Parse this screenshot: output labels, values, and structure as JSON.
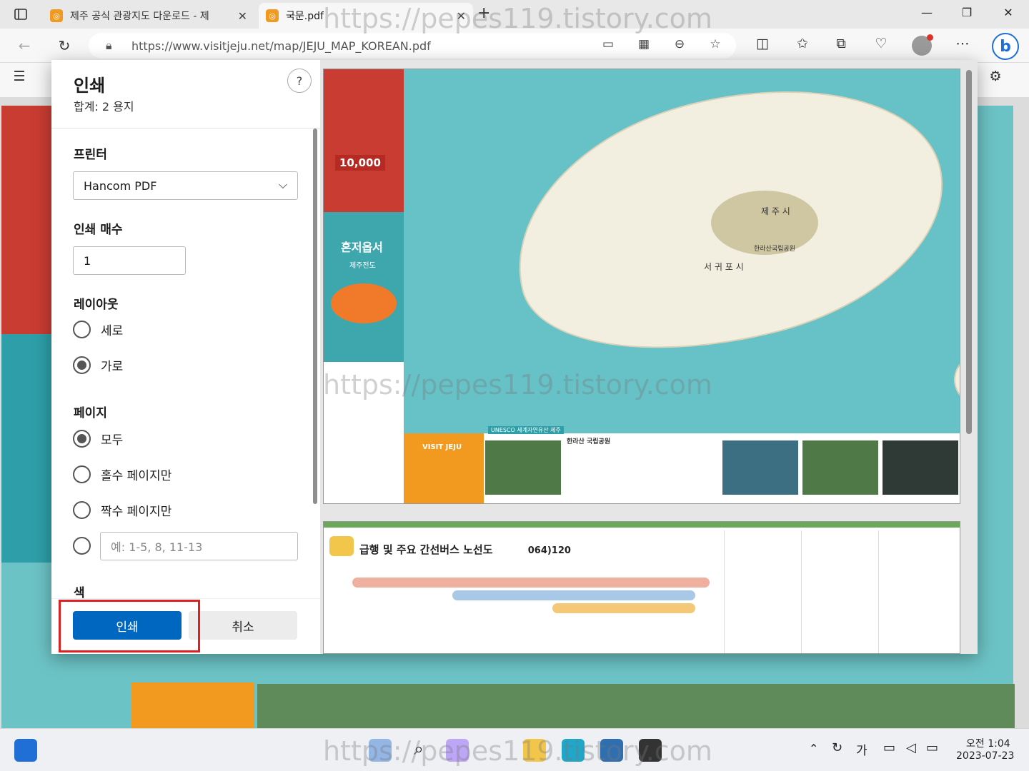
{
  "browser": {
    "tabs": [
      {
        "label": "제주 공식 관광지도 다운로드 - 제",
        "close": "✕"
      },
      {
        "label": "국문.pdf",
        "close": "✕"
      }
    ],
    "new_tab": "+",
    "address": "https://www.visitjeju.net/map/JEJU_MAP_KOREAN.pdf",
    "window_controls": {
      "minimize": "—",
      "restore": "❐",
      "close": "✕"
    }
  },
  "print_dialog": {
    "title": "인쇄",
    "total": "합계: 2 용지",
    "help": "?",
    "printer_label": "프린터",
    "printer_value": "Hancom PDF",
    "copies_label": "인쇄 매수",
    "copies_value": "1",
    "layout_label": "레이아웃",
    "layout_options": [
      {
        "label": "세로",
        "checked": false
      },
      {
        "label": "가로",
        "checked": true
      }
    ],
    "pages_label": "페이지",
    "pages_options": [
      {
        "label": "모두",
        "checked": true
      },
      {
        "label": "홀수 페이지만",
        "checked": false
      },
      {
        "label": "짝수 페이지만",
        "checked": false
      }
    ],
    "pages_custom_placeholder": "예: 1-5, 8, 11-13",
    "color_label": "색",
    "print_button": "인쇄",
    "cancel_button": "취소"
  },
  "preview": {
    "page1_labels": {
      "coupon": "10,000",
      "brochure_title": "혼저옵서",
      "brochure_sub": "제주전도",
      "city_north": "제 주 시",
      "city_south": "서 귀 포 시",
      "mountain": "한라산국립공원",
      "unesco": "UNESCO 세계자연유산 제주",
      "hallasan": "한라산 국립공원",
      "visit_jeju": "VISIT JEJU"
    },
    "page2_title": "급행 및 주요 간선버스 노선도",
    "page2_phone": "064)120"
  },
  "taskbar": {
    "time": "오전 1:04",
    "date": "2023-07-23",
    "ime": "가"
  },
  "watermark": "https://pepes119.tistory.com",
  "colors": {
    "accent": "#0067c0",
    "highlight": "#e02020",
    "map_sea": "#6cc3c5",
    "brand_orange": "#f29a1f"
  }
}
